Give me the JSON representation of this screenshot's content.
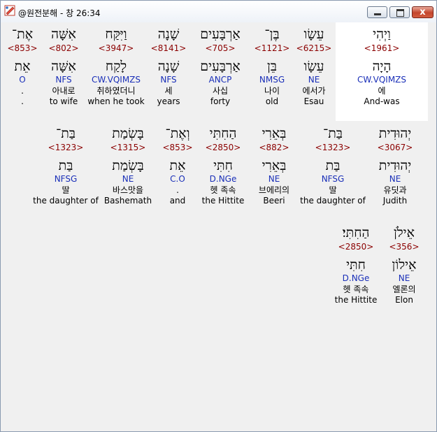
{
  "window": {
    "title": "@원전분해 - 창 26:34",
    "controls": {
      "minimize": "",
      "maximize": "",
      "close": "x"
    }
  },
  "rows": [
    {
      "words": [
        {
          "hebrew": "וַיְהִי",
          "strong": "<1961>",
          "lemma": "הָיָה",
          "morph": "CW.VQIMZS",
          "korean": "에",
          "english": "And-was",
          "selected": true
        },
        {
          "hebrew": "עֵשָׂו",
          "strong": "<6215>",
          "lemma": "עֵשָׂו",
          "morph": "NE",
          "korean": "에서가",
          "english": "Esau"
        },
        {
          "hebrew": "בֶּן־",
          "strong": "<1121>",
          "lemma": "בֵּן",
          "morph": "NMSG",
          "korean": "나이",
          "english": "old"
        },
        {
          "hebrew": "אַרְבָּעִים",
          "strong": "<705>",
          "lemma": "אַרְבָּעִים",
          "morph": "ANCP",
          "korean": "사십",
          "english": "forty"
        },
        {
          "hebrew": "שָׁנָה",
          "strong": "<8141>",
          "lemma": "שָׁנָה",
          "morph": "NFS",
          "korean": "세",
          "english": "years"
        },
        {
          "hebrew": "וַיִּקַּח",
          "strong": "<3947>",
          "lemma": "לָקַח",
          "morph": "CW.VQIMZS",
          "korean": "취하였더니",
          "english": "when he took"
        },
        {
          "hebrew": "אִשָּׁה",
          "strong": "<802>",
          "lemma": "אִשָּׁה",
          "morph": "NFS",
          "korean": "아내로",
          "english": "to wife"
        },
        {
          "hebrew": "אֶת־",
          "strong": "<853>",
          "lemma": "אֵת",
          "morph": "O",
          "korean": ".",
          "english": "."
        }
      ]
    },
    {
      "words": [
        {
          "hebrew": "יְהוּדִית",
          "strong": "<3067>",
          "lemma": "יְהוּדִית",
          "morph": "NE",
          "korean": "유딧과",
          "english": "Judith"
        },
        {
          "hebrew": "בַּת־",
          "strong": "<1323>",
          "lemma": "בַּת",
          "morph": "NFSG",
          "korean": "딸",
          "english": "the daughter of"
        },
        {
          "hebrew": "בְּאֵרִי",
          "strong": "<882>",
          "lemma": "בְּאֵרִי",
          "morph": "NE",
          "korean": "브에리의",
          "english": "Beeri"
        },
        {
          "hebrew": "הַחִתִּי",
          "strong": "<2850>",
          "lemma": "חִתִּי",
          "morph": "D.NGe",
          "korean": "헷 족속",
          "english": "the Hittite"
        },
        {
          "hebrew": "וְאֶת־",
          "strong": "<853>",
          "lemma": "אֵת",
          "morph": "C.O",
          "korean": ".",
          "english": "and"
        },
        {
          "hebrew": "בָּשְׂמַת",
          "strong": "<1315>",
          "lemma": "בָּשְׂמַת",
          "morph": "NE",
          "korean": "바스맛을",
          "english": "Bashemath"
        },
        {
          "hebrew": "בַּת־",
          "strong": "<1323>",
          "lemma": "בַּת",
          "morph": "NFSG",
          "korean": "딸",
          "english": "the daughter of"
        }
      ]
    },
    {
      "words": [
        {
          "hebrew": "אֵילֹן",
          "strong": "<356>",
          "lemma": "אֵילוֹן",
          "morph": "NE",
          "korean": "엘론의",
          "english": "Elon"
        },
        {
          "hebrew": "הַחִתִּי׃",
          "strong": "<2850>",
          "lemma": "חִתִּי",
          "morph": "D.NGe",
          "korean": "헷 족속",
          "english": "the Hittite"
        }
      ]
    }
  ]
}
